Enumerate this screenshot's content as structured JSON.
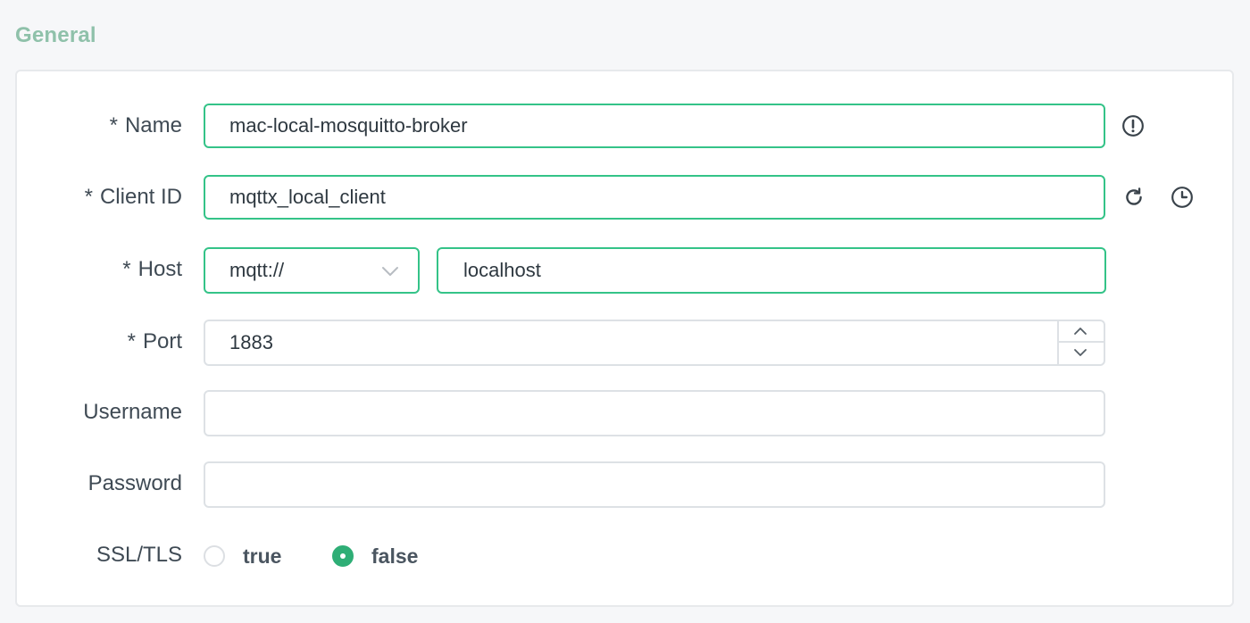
{
  "section": {
    "title": "General"
  },
  "form": {
    "name": {
      "required": "*",
      "label": "Name",
      "value": "mac-local-mosquitto-broker",
      "icon": "exclamation-circle-icon"
    },
    "client_id": {
      "required": "*",
      "label": "Client ID",
      "value": "mqttx_local_client",
      "icons": [
        "refresh-icon",
        "clock-icon"
      ]
    },
    "host": {
      "required": "*",
      "label": "Host",
      "protocol": "mqtt://",
      "value": "localhost"
    },
    "port": {
      "required": "*",
      "label": "Port",
      "value": "1883"
    },
    "username": {
      "label": "Username",
      "value": ""
    },
    "password": {
      "label": "Password",
      "value": ""
    },
    "ssl_tls": {
      "label": "SSL/TLS",
      "options": [
        "true",
        "false"
      ],
      "selected": "false"
    }
  },
  "colors": {
    "accent": "#34c388",
    "radio_checked": "#2fae76",
    "title": "#8fc1aa"
  }
}
